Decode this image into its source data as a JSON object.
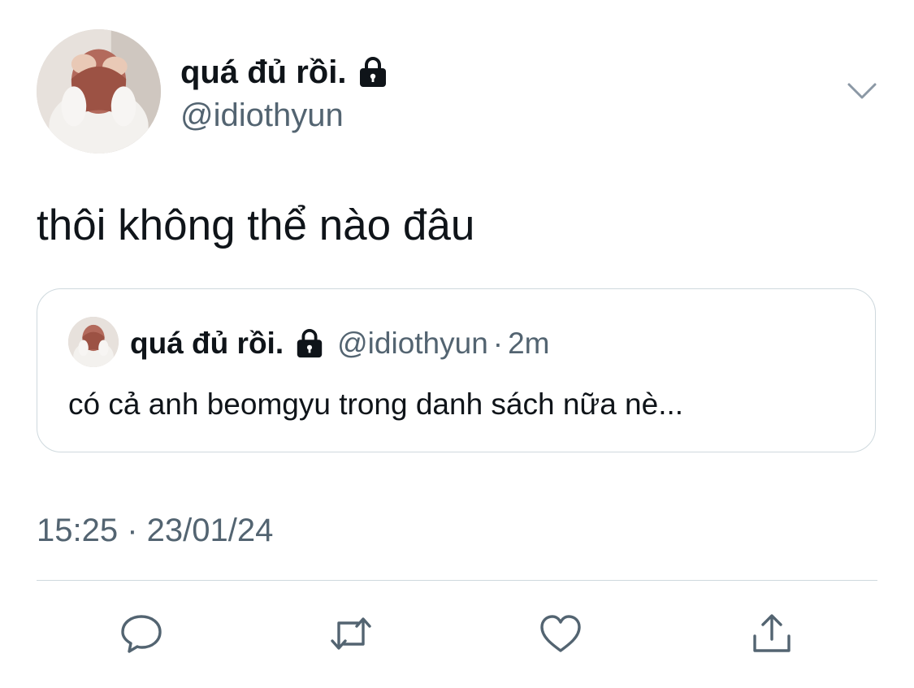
{
  "tweet": {
    "display_name": "quá đủ rồi.",
    "handle": "@idiothyun",
    "text": "thôi không thể nào đâu",
    "timestamp": "15:25 · 23/01/24",
    "protected_icon": "lock-icon",
    "menu_icon": "chevron-down-icon"
  },
  "quoted_tweet": {
    "display_name": "quá đủ rồi.",
    "handle": "@idiothyun",
    "separator": "·",
    "time": "2m",
    "text": "có cả anh beomgyu trong danh sách nữa nè..."
  },
  "actions": [
    {
      "name": "reply",
      "icon": "speech-bubble-icon"
    },
    {
      "name": "retweet",
      "icon": "retweet-arrows-icon"
    },
    {
      "name": "like",
      "icon": "heart-icon"
    },
    {
      "name": "share",
      "icon": "share-upload-icon"
    }
  ],
  "colors": {
    "text_primary": "#0f1419",
    "text_secondary": "#536471",
    "border": "#cfd9de",
    "icon": "#536471"
  }
}
